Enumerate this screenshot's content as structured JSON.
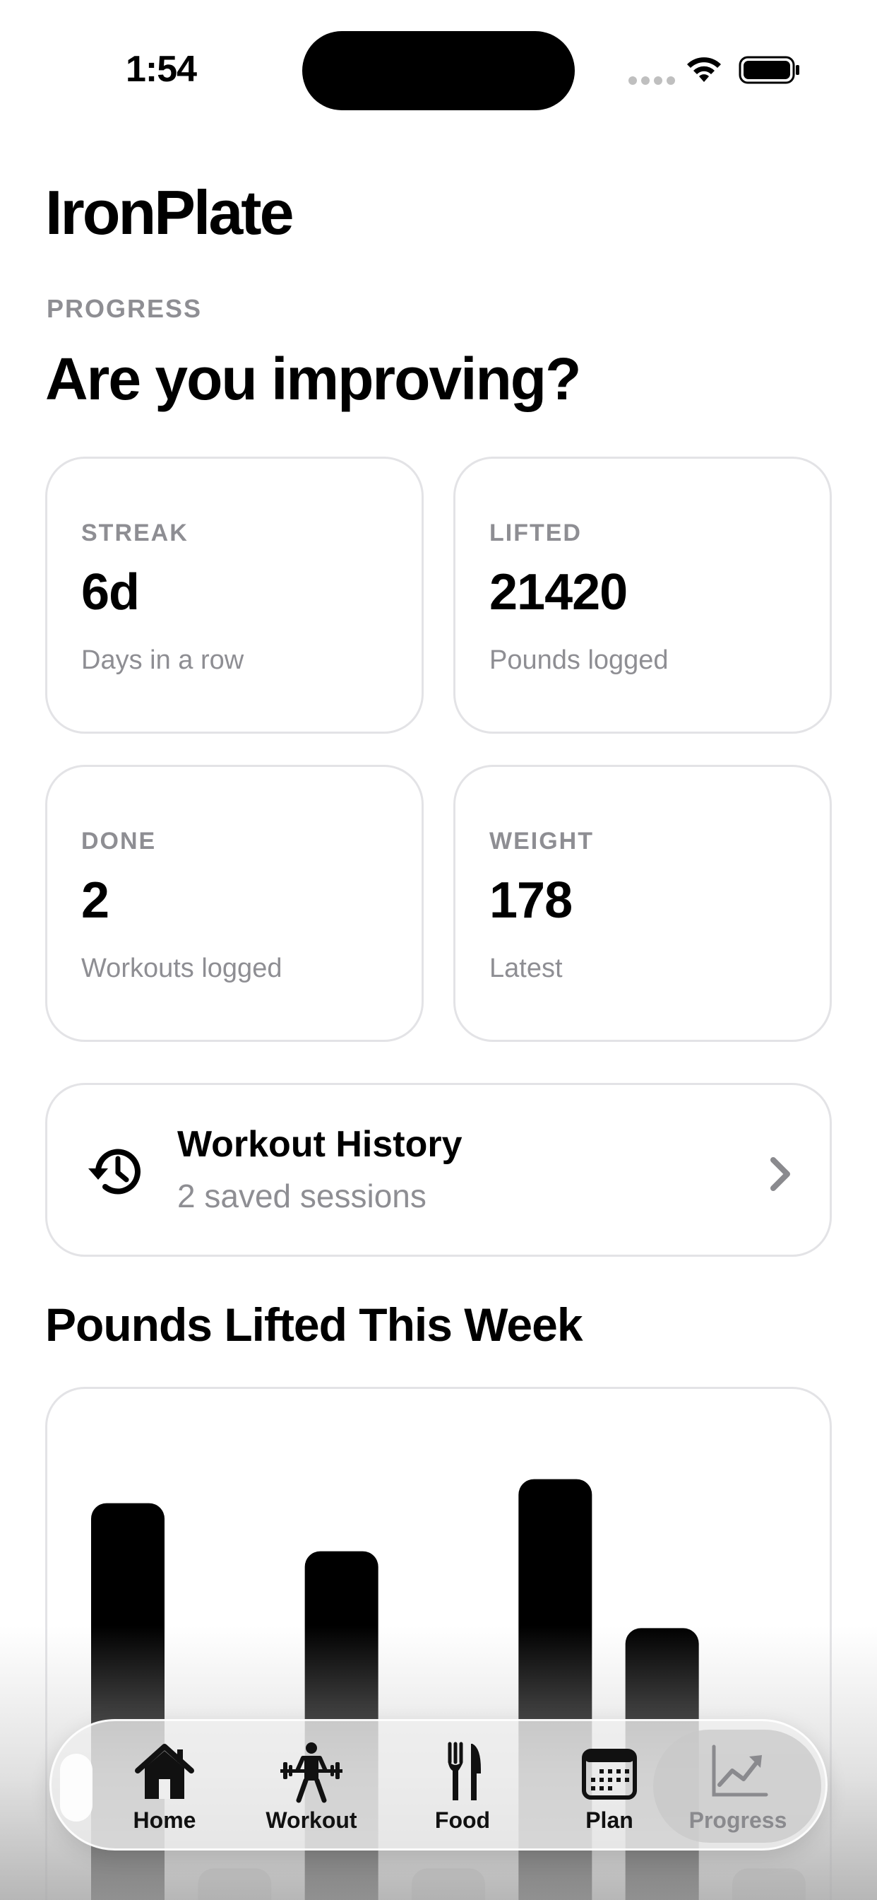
{
  "status_bar": {
    "time": "1:54"
  },
  "header": {
    "app_title": "IronPlate",
    "eyebrow": "PROGRESS",
    "heading": "Are you improving?"
  },
  "stats": [
    {
      "label": "STREAK",
      "value": "6d",
      "caption": "Days in a row"
    },
    {
      "label": "LIFTED",
      "value": "21420",
      "caption": "Pounds logged"
    },
    {
      "label": "DONE",
      "value": "2",
      "caption": "Workouts logged"
    },
    {
      "label": "WEIGHT",
      "value": "178",
      "caption": "Latest"
    }
  ],
  "history": {
    "title": "Workout History",
    "subtitle": "2 saved sessions",
    "icon": "history-icon"
  },
  "chart_data": {
    "type": "bar",
    "title": "Pounds Lifted This Week",
    "values": [
      0.88,
      0.12,
      0.78,
      0.12,
      0.93,
      0.62,
      0.12
    ],
    "ylim": [
      0,
      1
    ],
    "grid": false
  },
  "tab_bar": {
    "items": [
      {
        "label": "Home",
        "icon": "house-icon"
      },
      {
        "label": "Workout",
        "icon": "weightlifter-icon"
      },
      {
        "label": "Food",
        "icon": "fork-knife-icon"
      },
      {
        "label": "Plan",
        "icon": "calendar-icon"
      },
      {
        "label": "Progress",
        "icon": "chart-trend-icon"
      }
    ],
    "active": "Progress"
  },
  "colors": {
    "accent": "#000000",
    "muted_text": "#8e8e93",
    "card_border": "#e3e3e6",
    "placeholder_bar": "#e0e0e0"
  }
}
